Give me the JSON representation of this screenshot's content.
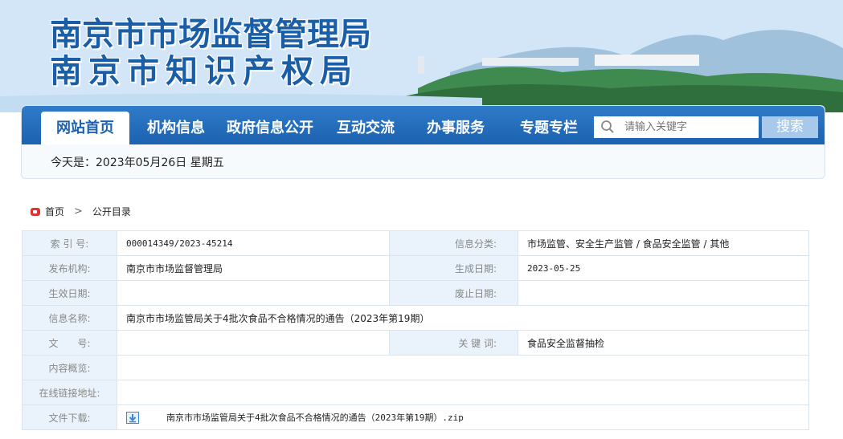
{
  "header": {
    "title_line1": "南京市市场监督管理局",
    "title_line2": "南京市知识产权局"
  },
  "nav": {
    "items": [
      {
        "label": "网站首页"
      },
      {
        "label": "机构信息"
      },
      {
        "label": "政府信息公开"
      },
      {
        "label": "互动交流"
      },
      {
        "label": "办事服务"
      },
      {
        "label": "专题专栏"
      }
    ],
    "active_index": 0,
    "search_placeholder": "请输入关键字",
    "search_button": "搜索"
  },
  "date_line": "今天是：2023年05月26日 星期五",
  "breadcrumb": {
    "home": "首页",
    "current": "公开目录"
  },
  "meta": {
    "index_label": "索 引 号:",
    "index_value": "000014349/2023-45214",
    "category_label": "信息分类:",
    "category_value": "市场监管、安全生产监管 / 食品安全监管 / 其他",
    "publisher_label": "发布机构:",
    "publisher_value": "南京市市场监督管理局",
    "created_label": "生成日期:",
    "created_value": "2023-05-25",
    "effective_label": "生效日期:",
    "effective_value": "",
    "expiry_label": "废止日期:",
    "expiry_value": "",
    "name_label": "信息名称:",
    "name_value": "南京市市场监管局关于4批次食品不合格情况的通告（2023年第19期）",
    "docno_label": "文　　号:",
    "docno_value": "",
    "keywords_label": "关 键 词:",
    "keywords_value": "食品安全监督抽检",
    "summary_label": "内容概览:",
    "summary_value": "",
    "link_label": "在线链接地址:",
    "link_value": "",
    "download_label": "文件下载:",
    "download_value": "南京市市场监管局关于4批次食品不合格情况的通告（2023年第19期）.zip"
  },
  "colors": {
    "nav_blue": "#1c62b0",
    "title_blue": "#1b5ea8",
    "label_bg": "#eaf3fb",
    "home_red": "#d23a3a"
  }
}
